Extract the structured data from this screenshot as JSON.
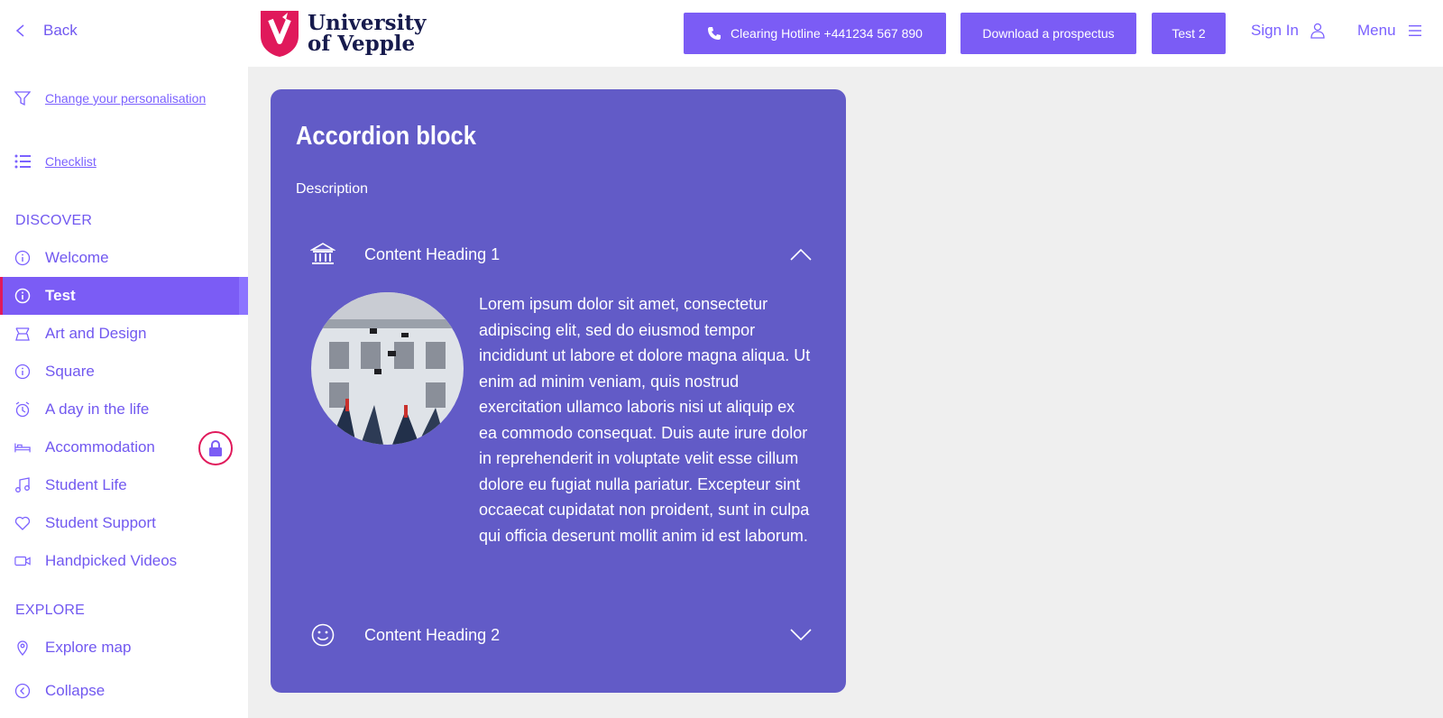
{
  "sidebar": {
    "back_label": "Back",
    "personalisation_label": "Change your personalisation",
    "checklist_label": "Checklist",
    "discover_heading": "DISCOVER",
    "discover_items": [
      {
        "label": "Welcome",
        "icon": "info-icon"
      },
      {
        "label": "Test",
        "icon": "info-icon",
        "active": true
      },
      {
        "label": "Art and Design",
        "icon": "palette-icon"
      },
      {
        "label": "Square",
        "icon": "info-icon"
      },
      {
        "label": "A day in the life",
        "icon": "alarm-clock-icon"
      },
      {
        "label": "Accommodation",
        "icon": "bed-icon",
        "locked": true
      },
      {
        "label": "Student Life",
        "icon": "music-note-icon"
      },
      {
        "label": "Student Support",
        "icon": "heart-icon"
      },
      {
        "label": "Handpicked Videos",
        "icon": "video-camera-icon"
      }
    ],
    "explore_heading": "EXPLORE",
    "explore_map_label": "Explore map",
    "collapse_label": "Collapse"
  },
  "header": {
    "logo_line1": "University",
    "logo_line2": "of Vepple",
    "hotline_label": "Clearing Hotline +441234 567 890",
    "prospectus_label": "Download a prospectus",
    "test2_label": "Test 2",
    "signin_label": "Sign In",
    "menu_label": "Menu"
  },
  "card": {
    "title": "Accordion block",
    "description": "Description",
    "items": [
      {
        "heading": "Content Heading 1",
        "icon": "bank-icon",
        "expanded": true,
        "body": "Lorem ipsum dolor sit amet, consectetur adipiscing elit, sed do eiusmod tempor incididunt ut labore et dolore magna aliqua. Ut enim ad minim veniam, quis nostrud exercitation ullamco laboris nisi ut aliquip ex ea commodo consequat. Duis aute irure dolor in reprehenderit in voluptate velit esse cillum dolore eu fugiat nulla pariatur. Excepteur sint occaecat cupidatat non proident, sunt in culpa qui officia deserunt mollit anim id est laborum."
      },
      {
        "heading": "Content Heading 2",
        "icon": "smiley-icon",
        "expanded": false
      }
    ]
  },
  "colors": {
    "accent": "#7b5cf5",
    "card": "#625bc7",
    "brand_red": "#e0195b",
    "logo_navy": "#171b4d"
  }
}
